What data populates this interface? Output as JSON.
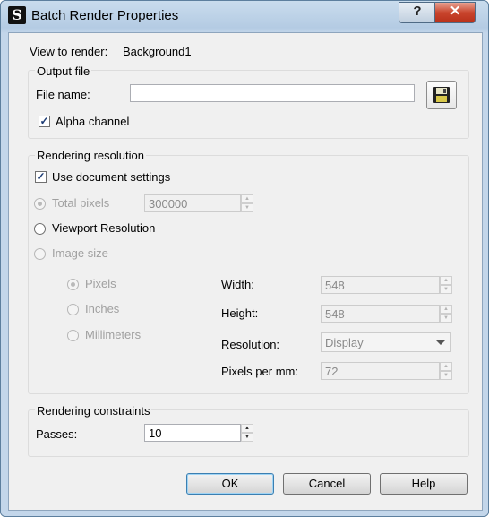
{
  "window": {
    "title": "Batch Render Properties",
    "app_icon_glyph": "S",
    "help_glyph": "?",
    "close_glyph": "✕"
  },
  "view": {
    "label": "View to render:",
    "value": "Background1"
  },
  "output": {
    "group_title": "Output file",
    "file_name_label": "File name:",
    "file_name_value": "",
    "alpha_label": "Alpha channel",
    "alpha_checked": true
  },
  "resolution": {
    "group_title": "Rendering resolution",
    "use_document_label": "Use document settings",
    "total_pixels_label": "Total pixels",
    "total_pixels_value": "300000",
    "viewport_label": "Viewport Resolution",
    "image_size_label": "Image size",
    "units": {
      "pixels": "Pixels",
      "inches": "Inches",
      "millimeters": "Millimeters"
    },
    "width_label": "Width:",
    "width_value": "548",
    "height_label": "Height:",
    "height_value": "548",
    "resolution_label": "Resolution:",
    "resolution_value": "Display",
    "ppm_label": "Pixels per mm:",
    "ppm_value": "72"
  },
  "constraints": {
    "group_title": "Rendering constraints",
    "passes_label": "Passes:",
    "passes_value": "10"
  },
  "buttons": {
    "ok": "OK",
    "cancel": "Cancel",
    "help": "Help"
  },
  "colors": {
    "title_bar": "#b4cbe3",
    "close_red": "#c9452d",
    "dialog_bg": "#f0f0f0"
  }
}
